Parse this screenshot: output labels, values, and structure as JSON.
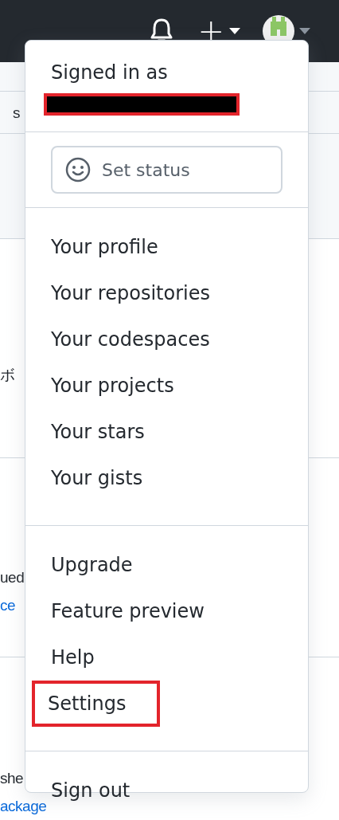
{
  "background": {
    "fragments": [
      {
        "text": "s",
        "kind": "text"
      },
      {
        "text": "ボ",
        "kind": "text"
      },
      {
        "text": "ued",
        "kind": "text"
      },
      {
        "text": "ce",
        "kind": "link"
      },
      {
        "text": "she",
        "kind": "text"
      },
      {
        "text": "ackage",
        "kind": "link"
      }
    ]
  },
  "header": {
    "plus_label": "+"
  },
  "menu": {
    "signed_in_label": "Signed in as",
    "username_redacted": true,
    "status_button": "Set status",
    "groups": [
      [
        {
          "label": "Your profile",
          "highlighted": false
        },
        {
          "label": "Your repositories",
          "highlighted": false
        },
        {
          "label": "Your codespaces",
          "highlighted": false
        },
        {
          "label": "Your projects",
          "highlighted": false
        },
        {
          "label": "Your stars",
          "highlighted": false
        },
        {
          "label": "Your gists",
          "highlighted": false
        }
      ],
      [
        {
          "label": "Upgrade",
          "highlighted": false
        },
        {
          "label": "Feature preview",
          "highlighted": false
        },
        {
          "label": "Help",
          "highlighted": false
        },
        {
          "label": "Settings",
          "highlighted": true
        }
      ],
      [
        {
          "label": "Sign out",
          "highlighted": false
        }
      ]
    ]
  }
}
